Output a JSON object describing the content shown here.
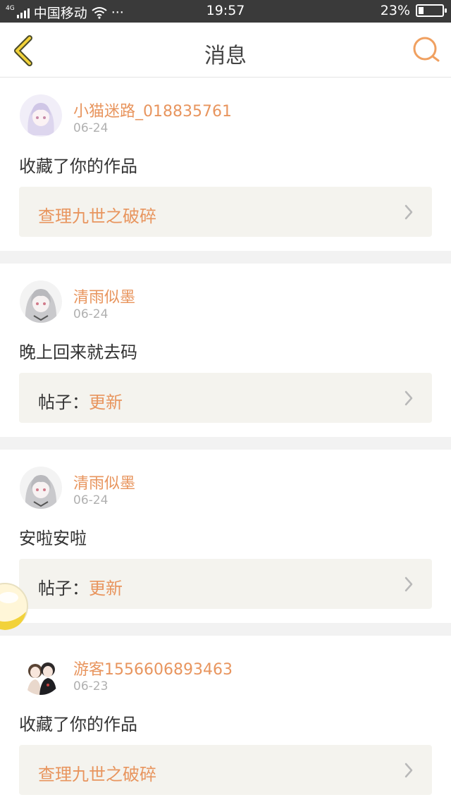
{
  "status_bar": {
    "network_tag": "4G",
    "carrier": "中国移动",
    "more": "···",
    "time": "19:57",
    "battery_percent": "23%",
    "battery_level": 0.23
  },
  "nav": {
    "title": "消息"
  },
  "messages": [
    {
      "user": "小猫迷路_018835761",
      "date": "06-24",
      "text": "收藏了你的作品",
      "ref_prefix": "",
      "ref_link": "查理九世之破碎"
    },
    {
      "user": "清雨似墨",
      "date": "06-24",
      "text": "晚上回来就去码",
      "ref_prefix": "帖子：",
      "ref_link": "更新"
    },
    {
      "user": "清雨似墨",
      "date": "06-24",
      "text": "安啦安啦",
      "ref_prefix": "帖子：",
      "ref_link": "更新"
    },
    {
      "user": "游客1556606893463",
      "date": "06-23",
      "text": "收藏了你的作品",
      "ref_prefix": "",
      "ref_link": "查理九世之破碎"
    }
  ]
}
